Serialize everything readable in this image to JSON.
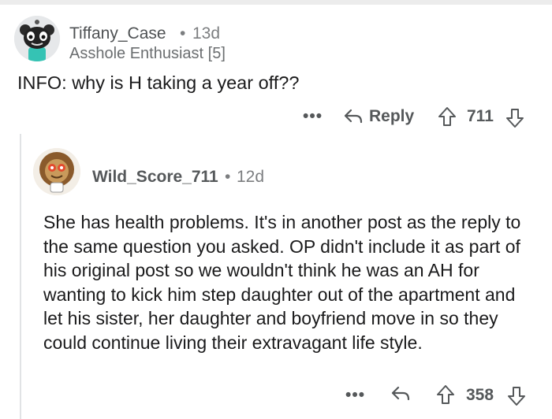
{
  "comment1": {
    "author": "Tiffany_Case",
    "separator": "•",
    "age": "13d",
    "flair": "Asshole Enthusiast [5]",
    "body": "INFO: why is H taking a year off??",
    "actions": {
      "more": "•••",
      "reply_label": "Reply",
      "score": "711"
    }
  },
  "comment2": {
    "author": "Wild_Score_711",
    "separator": "•",
    "age": "12d",
    "body": "She has health problems. It's in another post as the reply to the same question you asked. OP didn't include it as part of his original post so we wouldn't think he was an AH for wanting to kick him step daughter out of the apartment and let his sister, her daughter and boyfriend move in so they could continue living their extravagant life style.",
    "actions": {
      "more": "•••",
      "score": "358"
    }
  }
}
